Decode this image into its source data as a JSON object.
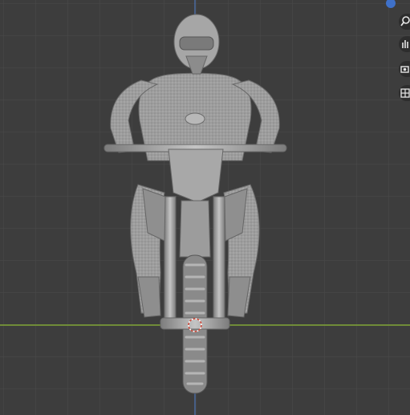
{
  "viewport": {
    "background": "#3d3d3d",
    "grid_color": "#4a4a4a",
    "axis_x_color": "#7ea334",
    "axis_y_color": "#4e74b8",
    "model_color": "#9a9a9a",
    "model_shadow": "#5a5a5a",
    "model_highlight": "#c8c8c8",
    "origin_color": "#d24a3a"
  },
  "gizmo": {
    "dot_color": "#3f71c9"
  },
  "nav": {
    "zoom": "zoom-icon",
    "pan": "pan-hand-icon",
    "camera": "camera-icon",
    "perspective": "grid-perspective-icon"
  }
}
